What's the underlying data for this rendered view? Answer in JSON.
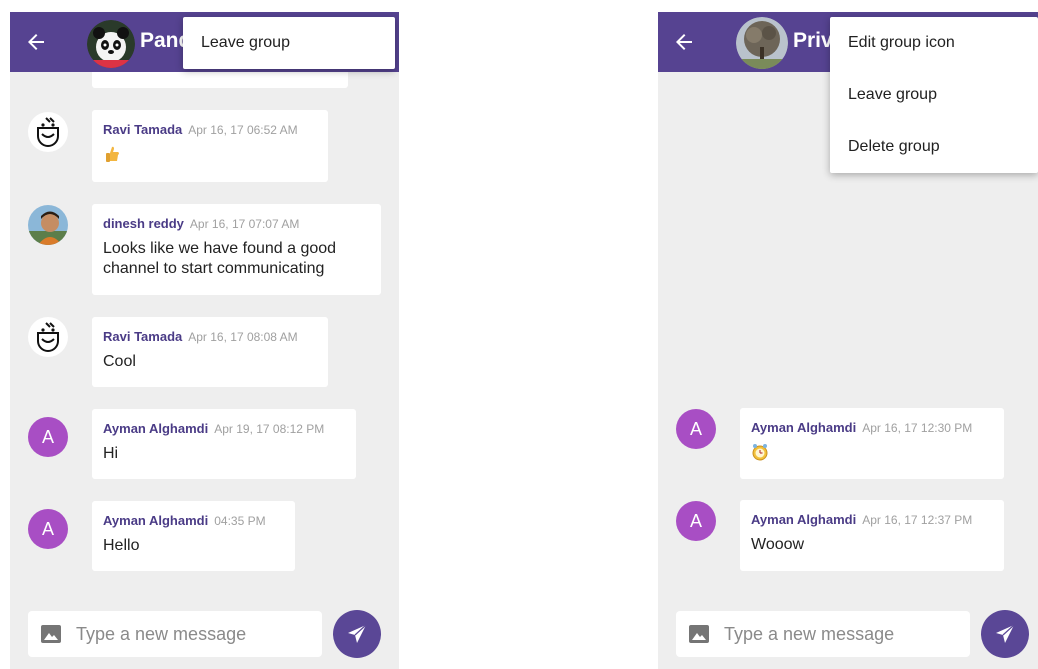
{
  "colors": {
    "appbar": "#564391",
    "sender": "#4a3b86",
    "letter_avatar": "#a84ec4",
    "send": "#5a4796"
  },
  "left": {
    "title": "Panda",
    "menu": [
      "Leave group"
    ],
    "messages": [
      {
        "sender": "Ravi Tamada",
        "time": "Apr 16, 17 06:52 AM",
        "text": "",
        "emoji": "thumbs-up-emoji",
        "avatar": "robot"
      },
      {
        "sender": "dinesh reddy",
        "time": "Apr 16, 17 07:07 AM",
        "text": "Looks like we have found a good channel to start communicating",
        "avatar": "photo"
      },
      {
        "sender": "Ravi Tamada",
        "time": "Apr 16, 17 08:08 AM",
        "text": "Cool",
        "avatar": "robot"
      },
      {
        "sender": "Ayman Alghamdi",
        "time": "Apr 19, 17 08:12 PM",
        "text": "Hi",
        "avatar": "A"
      },
      {
        "sender": "Ayman Alghamdi",
        "time": "04:35 PM",
        "text": "Hello",
        "avatar": "A"
      }
    ],
    "input_placeholder": "Type a new message"
  },
  "right": {
    "title": "Private",
    "menu": [
      "Edit group icon",
      "Leave group",
      "Delete group"
    ],
    "messages": [
      {
        "sender": "Ayman Alghamdi",
        "time": "Apr 16, 17 12:30 PM",
        "text": "",
        "emoji": "clock-face-emoji",
        "avatar": "A"
      },
      {
        "sender": "Ayman Alghamdi",
        "time": "Apr 16, 17 12:37 PM",
        "text": "Wooow",
        "avatar": "A"
      }
    ],
    "input_placeholder": "Type a new message"
  }
}
